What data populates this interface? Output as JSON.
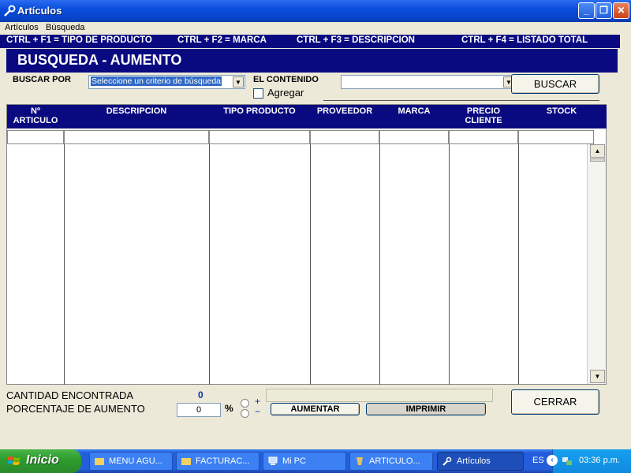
{
  "window": {
    "title": "Artículos"
  },
  "menu": {
    "items": [
      "Artículos",
      "Búsqueda"
    ]
  },
  "hotkeys": [
    "CTRL + F1 = TIPO DE PRODUCTO",
    "CTRL + F2 = MARCA",
    "CTRL + F3 = DESCRIPCION",
    "CTRL + F4 = LISTADO TOTAL"
  ],
  "header": {
    "title": "BUSQUEDA - AUMENTO"
  },
  "search": {
    "buscar_por_label": "BUSCAR POR",
    "criterio_value": "Seleccione un criterio de búsqueda",
    "contenido_label": "EL CONTENIDO",
    "contenido_value": "",
    "agregar_label": "Agregar",
    "buscar_button": "BUSCAR"
  },
  "grid": {
    "columns": [
      "Nº\nARTICULO",
      "DESCRIPCION",
      "TIPO PRODUCTO",
      "PROVEEDOR",
      "MARCA",
      "PRECIO\nCLIENTE",
      "STOCK"
    ],
    "rows": []
  },
  "bottom": {
    "cantidad_label": "CANTIDAD ENCONTRADA",
    "cantidad_value": "0",
    "porcentaje_label": "PORCENTAJE DE AUMENTO",
    "porcentaje_value": "0",
    "percent_symbol": "%",
    "plus": "+",
    "minus": "−",
    "aumentar_button": "AUMENTAR",
    "imprimir_button": "IMPRIMIR",
    "cerrar_button": "CERRAR"
  },
  "taskbar": {
    "start_label": "Inicio",
    "buttons": [
      "MENU AGU...",
      "FACTURAC...",
      "Mi PC",
      "ARTICULO...",
      "Artículos"
    ],
    "language": "ES",
    "time": "03:36 p.m."
  },
  "colors": {
    "navy": "#0a0a80",
    "xp_blue": "#0842c8",
    "selection": "#316ac5"
  }
}
